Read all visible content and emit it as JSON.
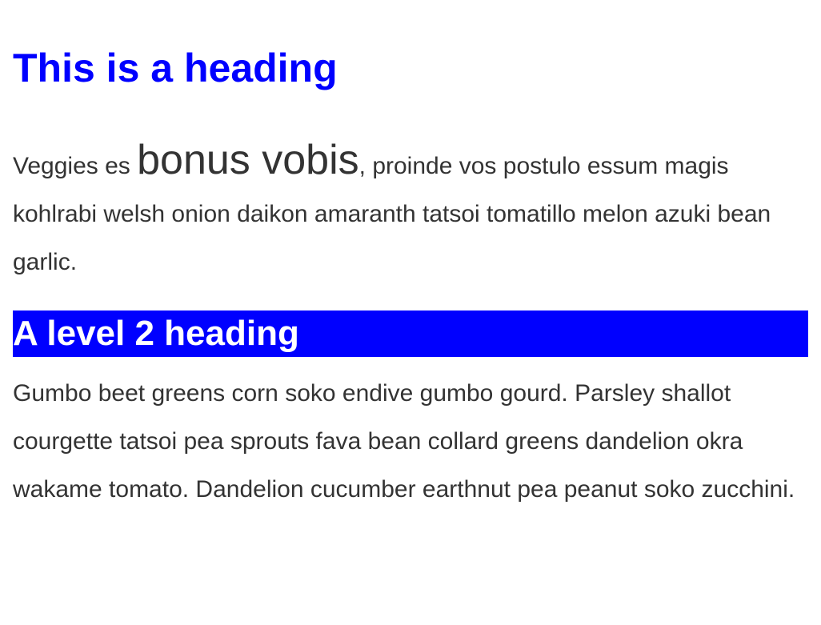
{
  "heading1": "This is a heading",
  "paragraph1": {
    "before": "Veggies es ",
    "emphasis": "bonus vobis",
    "after": ", proinde vos postulo essum magis kohlrabi welsh onion daikon amaranth tatsoi tomatillo melon azuki bean garlic."
  },
  "heading2": "A level 2 heading",
  "paragraph2": "Gumbo beet greens corn soko endive gumbo gourd. Parsley shallot courgette tatsoi pea sprouts fava bean collard greens dandelion okra wakame tomato. Dandelion cucumber earthnut pea peanut soko zucchini."
}
